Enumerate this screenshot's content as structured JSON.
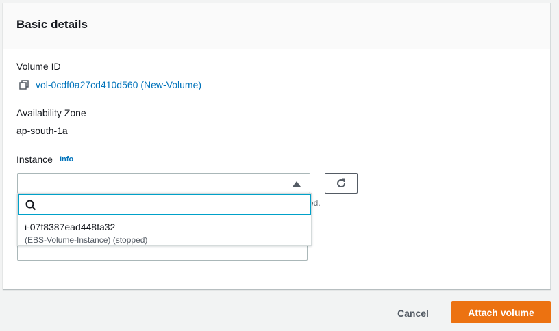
{
  "panel": {
    "title": "Basic details"
  },
  "volume": {
    "label": "Volume ID",
    "link_text": "vol-0cdf0a27cd410d560 (New-Volume)"
  },
  "availability_zone": {
    "label": "Availability Zone",
    "value": "ap-south-1a"
  },
  "instance": {
    "label": "Instance",
    "info_link": "Info",
    "selected_value": "",
    "hint_fragment": "ed.",
    "filter_placeholder": "",
    "options": [
      {
        "id": "i-07f8387ead448fa32",
        "description": "(EBS-Volume-Instance) (stopped)"
      }
    ]
  },
  "footer": {
    "cancel_label": "Cancel",
    "attach_label": "Attach volume"
  },
  "colors": {
    "link": "#0073bb",
    "primary_button": "#ec7211",
    "focus_ring": "#00a1c9"
  },
  "icons": {
    "copy": "copy-icon",
    "caret": "caret-up-icon",
    "refresh": "refresh-icon",
    "search": "search-icon"
  }
}
